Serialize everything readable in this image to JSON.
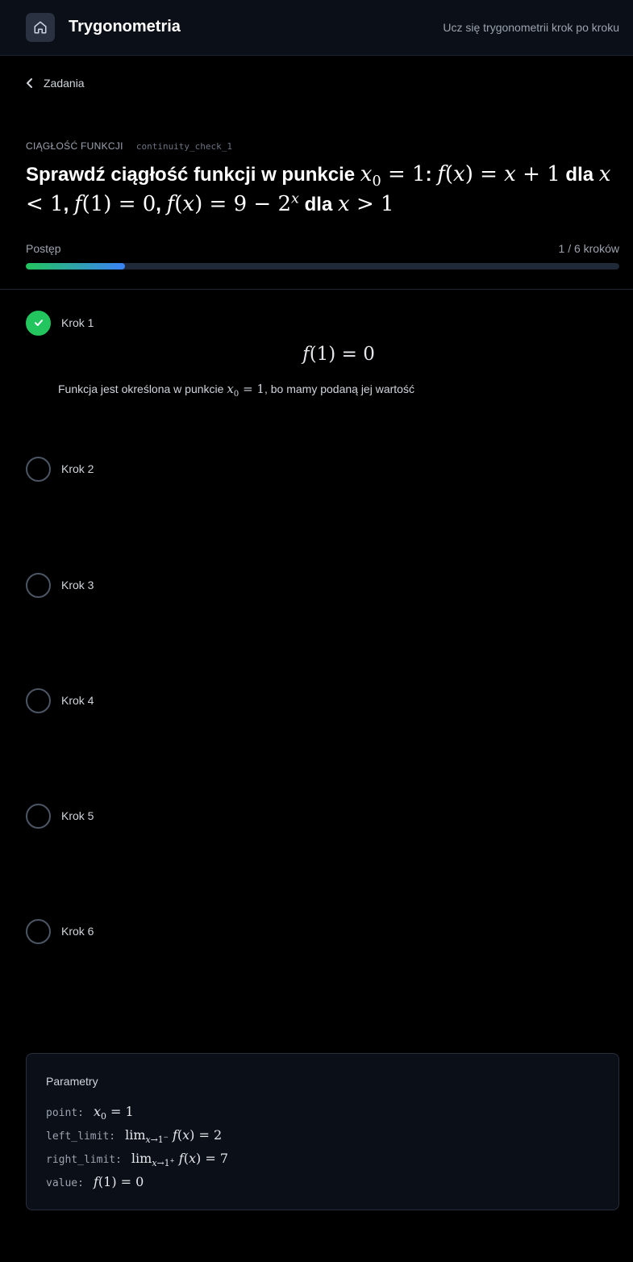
{
  "header": {
    "home_icon": "home-icon",
    "title": "Trygonometria",
    "tagline": "Ucz się trygonometrii krok po kroku"
  },
  "nav": {
    "back_icon": "chevron-left-icon",
    "back_label": "Zadania"
  },
  "task": {
    "category": "CIĄGŁOŚĆ FUNKCJI",
    "id": "continuity_check_1",
    "title_parts": [
      "Sprawdź ciągłość funkcji w punkcie",
      ":",
      "dla",
      ",",
      ",",
      "dla"
    ]
  },
  "progress": {
    "label": "Postęp",
    "count_text": "1 / 6 kroków",
    "value": 0.1667,
    "gradient_start": "#22c55e",
    "gradient_end": "#3b82f6"
  },
  "steps": [
    {
      "label": "Krok 1",
      "status": "done",
      "formula": "f(1) = 0",
      "desc_before": "Funkcja jest określona w punkcie",
      "desc_after": ", bo mamy podaną jej wartość"
    },
    {
      "label": "Krok 2",
      "status": "pending"
    },
    {
      "label": "Krok 3",
      "status": "pending"
    },
    {
      "label": "Krok 4",
      "status": "pending"
    },
    {
      "label": "Krok 5",
      "status": "pending"
    },
    {
      "label": "Krok 6",
      "status": "pending"
    }
  ],
  "params": {
    "title": "Parametry",
    "rows": [
      {
        "key": "point:"
      },
      {
        "key": "left_limit:"
      },
      {
        "key": "right_limit:"
      },
      {
        "key": "value:"
      }
    ]
  },
  "colors": {
    "background": "#000000",
    "header_bg": "#0b0f17",
    "success": "#22c55e",
    "accent": "#3b82f6"
  }
}
